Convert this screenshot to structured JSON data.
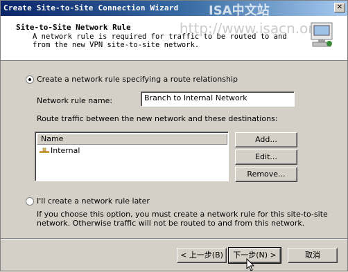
{
  "window": {
    "title": "Create Site-to-Site Connection Wizard",
    "watermark_title": "ISA中文站"
  },
  "header": {
    "title": "Site-to-Site Network Rule",
    "description": "A network rule is required for traffic to be routed to and from the new VPN site-to-site network.",
    "watermark_url": "http://www.isacn.org",
    "icon": "wizard-network-icon"
  },
  "option_create": {
    "label": "Create a network rule specifying a route relationship",
    "checked": true
  },
  "rule_name": {
    "label": "Network rule name:",
    "value": "Branch to Internal Network"
  },
  "destinations": {
    "label": "Route traffic between the new network and these destinations:",
    "column_header": "Name",
    "items": [
      {
        "name": "Internal",
        "icon": "network-icon"
      }
    ]
  },
  "side_buttons": {
    "add": "Add...",
    "edit": "Edit...",
    "remove": "Remove..."
  },
  "option_later": {
    "label": "I'll create a network rule later",
    "checked": false,
    "note": "If you choose this option, you must create a network rule for this site-to-site network. Otherwise traffic will not be routed to and from this network."
  },
  "footer": {
    "back": "< 上一步(B)",
    "next": "下一步(N) >",
    "cancel": "取消"
  }
}
